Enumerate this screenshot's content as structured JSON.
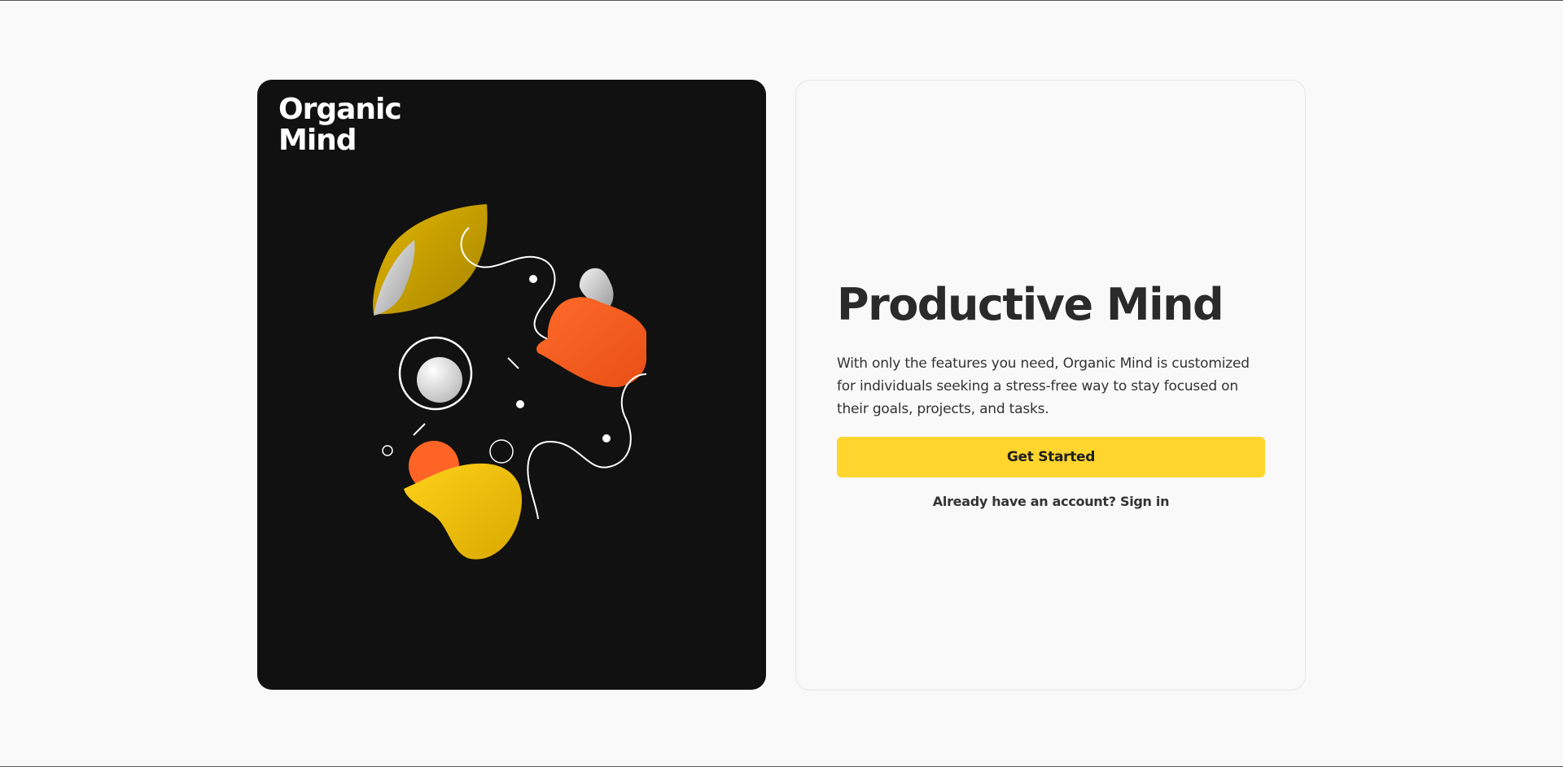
{
  "brand": {
    "logo_line1": "Organic",
    "logo_line2": "Mind"
  },
  "hero": {
    "title": "Productive Mind",
    "description": "With only the features you need, Organic Mind is customized for individuals seeking a stress-free way to stay focused on their goals, projects, and tasks.",
    "cta_label": "Get Started",
    "signin_prompt": "Already have an account?",
    "signin_link": "Sign in"
  },
  "colors": {
    "accent": "#ffd52e",
    "art_background": "#111111",
    "orange": "#ff6427",
    "page_background": "#f9f9f9"
  },
  "illustration": {
    "icon": "abstract-organic-shapes-illustration"
  }
}
